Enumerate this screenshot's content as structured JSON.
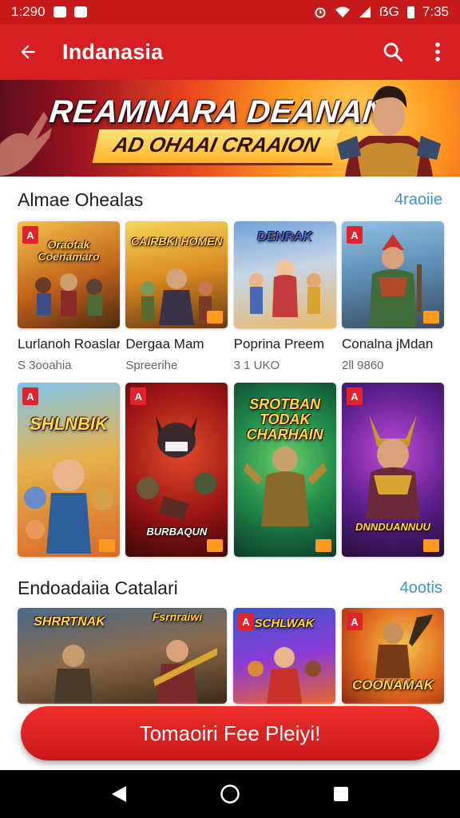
{
  "status_bar": {
    "time_left": "1:290",
    "signal_text": "ẞG",
    "time_right": "7:35"
  },
  "app_bar": {
    "title": "Indanasia",
    "back_icon": "arrow-left-icon",
    "search_icon": "search-icon",
    "more_icon": "more-vert-icon"
  },
  "banner": {
    "title": "REAMNARA DEANAN",
    "subtitle": "AD OHAAI CRAAION"
  },
  "section1": {
    "title": "Almae Ohealas",
    "see_all": "4raoiie",
    "games": [
      {
        "logo": "Oraotak Coenamaro",
        "name": "Lurlanoh Roaslara",
        "meta": "S 3ooahia",
        "badge": "A"
      },
      {
        "logo": "CAIRBKI HOMEN",
        "name": "Dergaa Mam",
        "meta": "Spreerihe",
        "badge": ""
      },
      {
        "logo": "DENRAK",
        "name": "Poprina Preem",
        "meta": "3 1 UKO",
        "badge": ""
      },
      {
        "logo": "",
        "name": "Conalna jMdan",
        "meta": "2ll 9860",
        "badge": "A"
      }
    ]
  },
  "section1_row2": {
    "games": [
      {
        "logo": "SHLNBIK",
        "badge": "A"
      },
      {
        "logo": "BURBAQUN",
        "badge": "A"
      },
      {
        "logo": "SROTBAN TODAK CHARHAIN",
        "badge": ""
      },
      {
        "logo": "DNNDUANNUU",
        "badge": "A"
      }
    ]
  },
  "section2": {
    "title": "Endoadaiia Catalari",
    "see_all": "4ootis",
    "games": [
      {
        "logo": "SHRRTNAK",
        "badge": ""
      },
      {
        "logo": "Fsrnraiwi",
        "badge": ""
      },
      {
        "logo": "SCHLWAK",
        "badge": "A"
      },
      {
        "logo": "COONAMAK",
        "badge": "A"
      }
    ]
  },
  "cta": {
    "label": "Tomaoiri Fee Pleiyi!"
  },
  "nav_bar": {
    "back_icon": "nav-back-icon",
    "home_icon": "nav-home-icon",
    "recents_icon": "nav-recents-icon"
  },
  "colors": {
    "primary": "#d71e22",
    "link": "#3e93d4",
    "nav": "#000000"
  }
}
